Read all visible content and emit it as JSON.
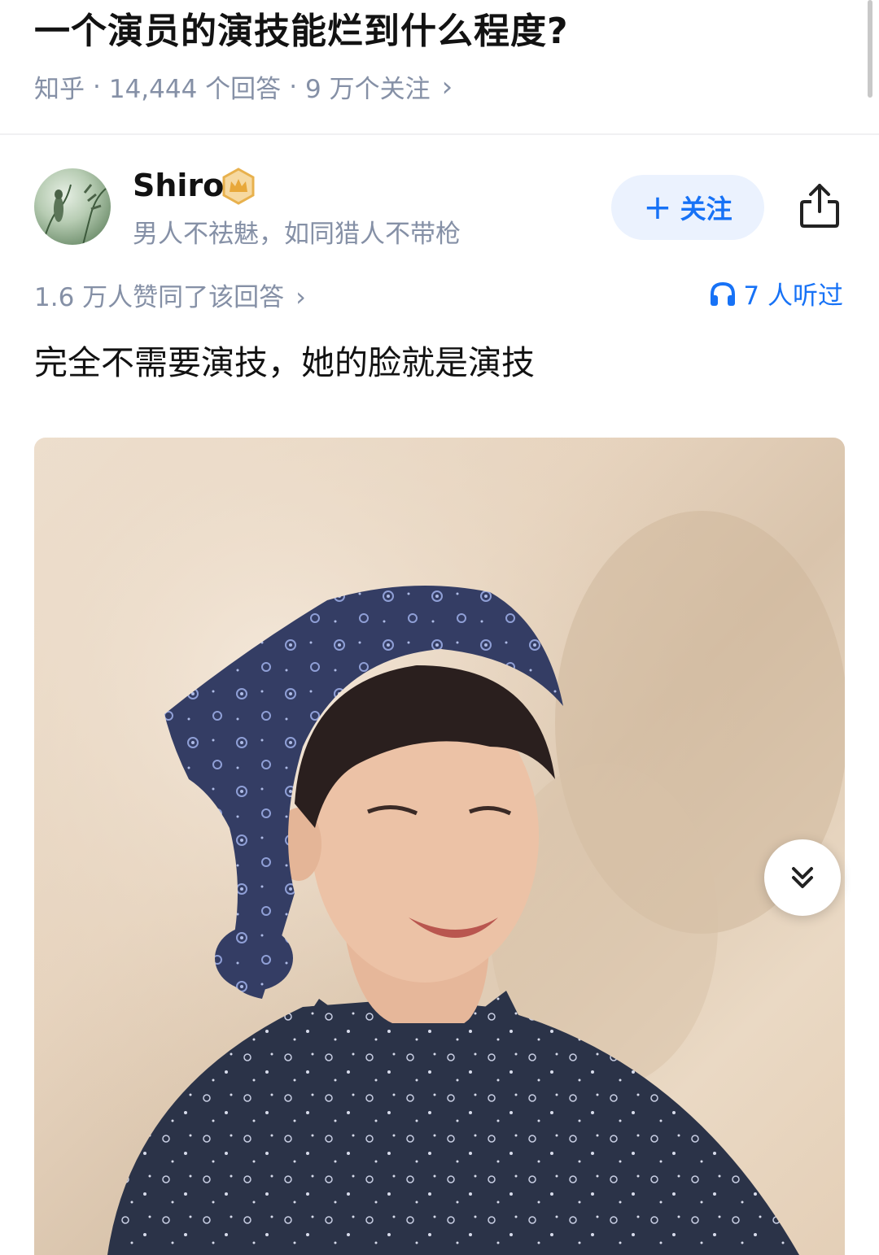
{
  "question": {
    "title": "一个演员的演技能烂到什么程度?",
    "source": "知乎",
    "answers": "14,444 个回答",
    "followers": "9 万个关注",
    "separator": "·",
    "chevron": "›"
  },
  "author": {
    "name": "Shiro",
    "bio": "男人不祛魅，如同猎人不带枪",
    "badge_icon": "crown-badge-icon",
    "badge_color": "#e8b14d"
  },
  "actions": {
    "follow_plus": "+",
    "follow_label": "关注",
    "share_icon": "share-icon",
    "accent_color": "#1772f6"
  },
  "answer": {
    "votes": "1.6 万人赞同了该回答",
    "chevron": "›",
    "listen_icon": "headphones-icon",
    "listeners": "7 人听过",
    "text": "完全不需要演技，她的脸就是演技",
    "image_description_icon": "photo-image",
    "scroll_down_icon": "double-chevron-down-icon"
  }
}
